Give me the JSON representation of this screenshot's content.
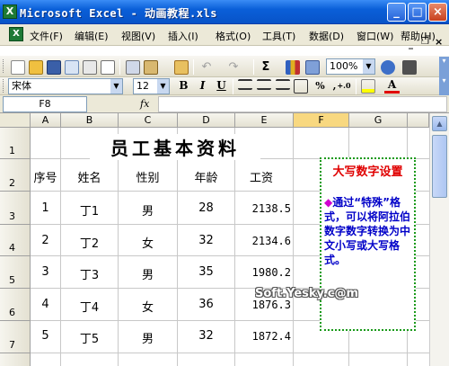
{
  "window": {
    "title": "Microsoft Excel - 动画教程.xls",
    "app_icon_glyph": "X",
    "minimize": "_",
    "maximize": "□",
    "close": "×"
  },
  "menu": {
    "items": [
      "文件(F)",
      "编辑(E)",
      "视图(V)",
      "插入(I)",
      "格式(O)",
      "工具(T)",
      "数据(D)",
      "窗口(W)",
      "帮助(H)"
    ],
    "doc_minimize": "_",
    "doc_restore": "❐",
    "doc_close": "×"
  },
  "standard_toolbar": {
    "sum": "Σ",
    "zoom": "100%"
  },
  "format_toolbar": {
    "font": "宋体",
    "size": "12",
    "bold": "B",
    "italic": "I",
    "underline": "U",
    "currency": "%",
    "comma": ",",
    "decimal_increase": "+.0",
    "decimal_decrease": ".00",
    "font_color_letter": "A"
  },
  "formula_bar": {
    "name_box": "F8",
    "fx": "fx",
    "formula": ""
  },
  "columns": [
    "A",
    "B",
    "C",
    "D",
    "E",
    "F",
    "G"
  ],
  "rows": [
    "1",
    "2",
    "3",
    "4",
    "5",
    "6",
    "7"
  ],
  "sheet": {
    "title": "员工基本资料",
    "headers": [
      "序号",
      "姓名",
      "性别",
      "年龄",
      "工资"
    ],
    "records": [
      [
        "1",
        "丁1",
        "男",
        "28",
        "2138.5"
      ],
      [
        "2",
        "丁2",
        "女",
        "32",
        "2134.6"
      ],
      [
        "3",
        "丁3",
        "男",
        "35",
        "1980.2"
      ],
      [
        "4",
        "丁4",
        "女",
        "36",
        "1876.3"
      ],
      [
        "5",
        "丁5",
        "男",
        "32",
        "1872.4"
      ]
    ]
  },
  "note": {
    "title": "大写数字设置",
    "bullet": "◆",
    "body": "通过“特殊”格式，可以将阿拉伯数字数字转换为中文小写或大写格式。"
  },
  "watermark": "Soft.Yesky.c@m",
  "colors": {
    "titlebar": "#0a5fd8",
    "note_title": "#e00000",
    "note_text": "#0000c8",
    "note_border": "#1a9a1a",
    "active_column": "#f8d880"
  }
}
